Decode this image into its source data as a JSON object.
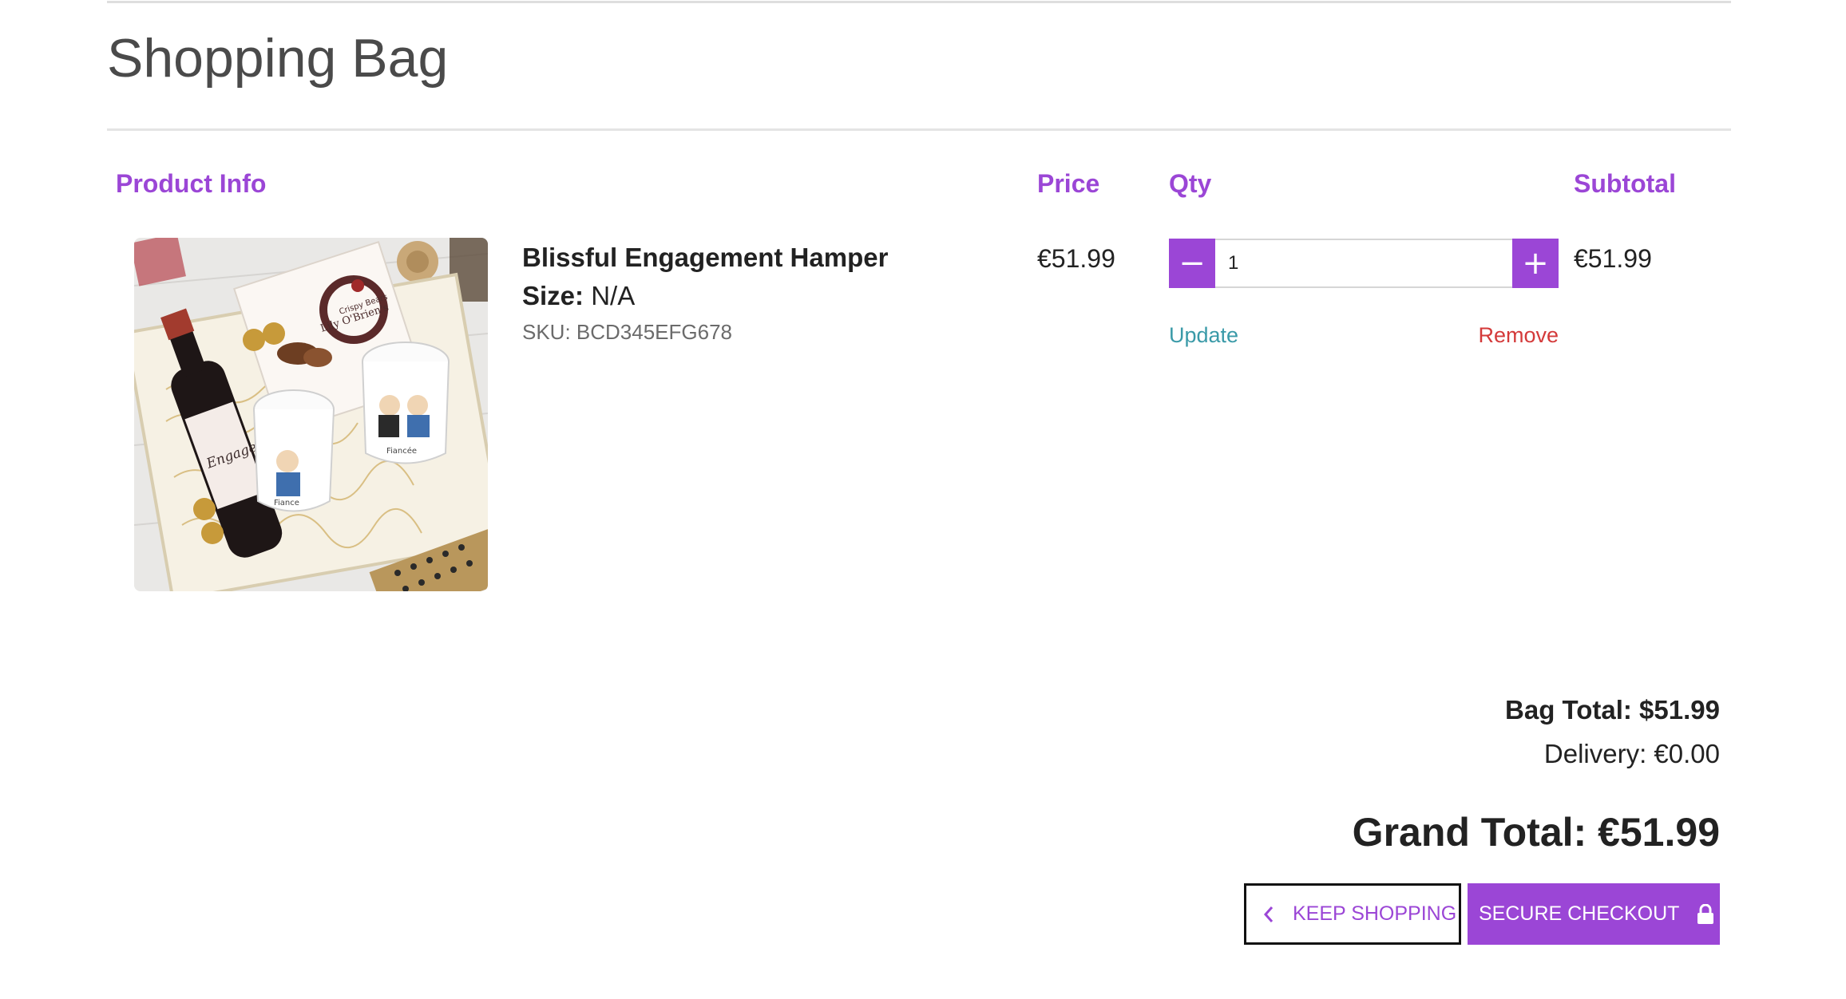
{
  "page": {
    "title": "Shopping Bag"
  },
  "columns": {
    "product_info": "Product Info",
    "price": "Price",
    "qty": "Qty",
    "subtotal": "Subtotal"
  },
  "items": [
    {
      "name": "Blissful Engagement Hamper",
      "size_label": "Size:",
      "size_value": "N/A",
      "sku": "SKU: BCD345EFG678",
      "price": "€51.99",
      "quantity": "1",
      "subtotal": "€51.99",
      "update_label": "Update",
      "remove_label": "Remove",
      "image_icon": "gift-hamper-photo",
      "image_label_lily": "Lily O'Brien's",
      "image_label_crispy": "Crispy Bears",
      "image_label_bottle": "Engaged",
      "image_label_mug_1": "Fiance",
      "image_label_mug_2": "Fiancée"
    }
  ],
  "qty_controls": {
    "decrement_icon": "minus-icon",
    "increment_icon": "plus-icon",
    "decrement_symbol": "−",
    "increment_symbol": "+"
  },
  "totals": {
    "bag_total": "Bag Total: $51.99",
    "delivery": "Delivery: €0.00",
    "grand_total": "Grand Total: €51.99"
  },
  "actions": {
    "keep_shopping": "KEEP SHOPPING",
    "keep_shopping_icon": "chevron-left-icon",
    "secure_checkout": "SECURE CHECKOUT",
    "secure_checkout_icon": "lock-icon"
  },
  "colors": {
    "accent": "#9b46d6",
    "update_link": "#3a9aa8",
    "remove_link": "#d43a3a",
    "heading_text": "#4a4a4a"
  }
}
